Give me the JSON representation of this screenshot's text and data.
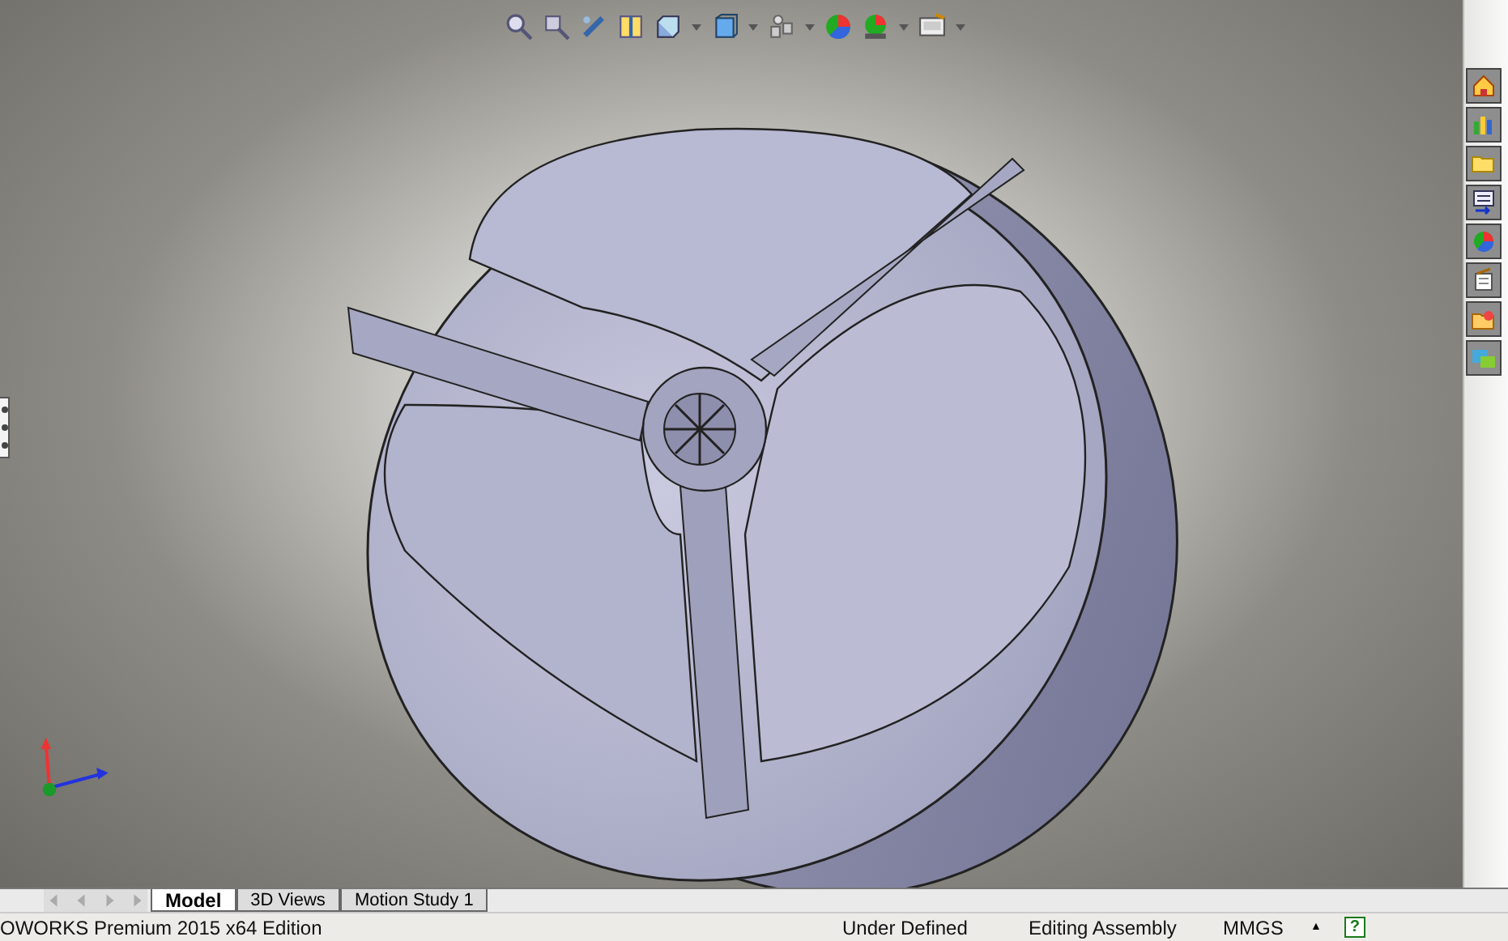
{
  "tabs": [
    {
      "label": "Model",
      "selected": true
    },
    {
      "label": "3D Views",
      "selected": false
    },
    {
      "label": "Motion Study 1",
      "selected": false
    }
  ],
  "status_bar": {
    "title": "OWORKS Premium 2015 x64 Edition",
    "state": "Under Defined",
    "mode": "Editing Assembly",
    "units": "MMGS",
    "units_caret": "▲",
    "help": "?"
  }
}
